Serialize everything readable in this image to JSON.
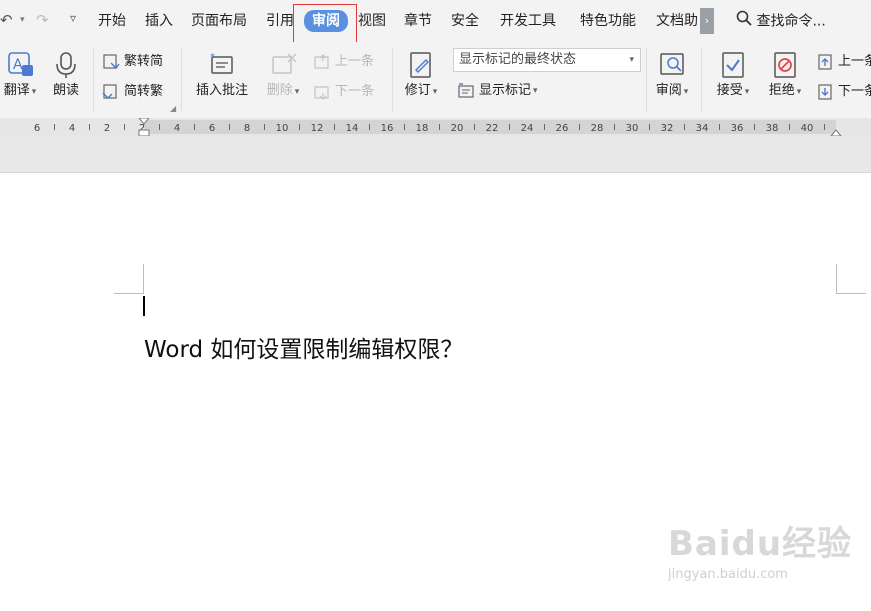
{
  "menu": {
    "tabs": [
      {
        "label": "开始"
      },
      {
        "label": "插入"
      },
      {
        "label": "页面布局"
      },
      {
        "label": "引用"
      },
      {
        "label": "审阅",
        "active": true
      },
      {
        "label": "视图"
      },
      {
        "label": "章节"
      },
      {
        "label": "安全"
      },
      {
        "label": "开发工具"
      },
      {
        "label": "特色功能"
      },
      {
        "label": "文档助"
      }
    ],
    "search_label": "查找命令...",
    "more_label": "›"
  },
  "ribbon": {
    "translate": "翻译",
    "read_aloud": "朗读",
    "to_traditional": "繁转简",
    "to_simplified": "简转繁",
    "insert_comment": "插入批注",
    "delete": "删除",
    "prev_comment": "上一条",
    "next_comment": "下一条",
    "track_changes": "修订",
    "markup_state": "显示标记的最终状态",
    "show_markup": "显示标记",
    "review_pane": "审阅",
    "accept": "接受",
    "reject": "拒绝",
    "prev_change": "上一条",
    "next_change": "下一条"
  },
  "ruler": {
    "labels": [
      "6",
      "4",
      "2",
      "2",
      "4",
      "6",
      "8",
      "10",
      "12",
      "14",
      "16",
      "18",
      "20",
      "22",
      "24",
      "26",
      "28",
      "30",
      "32",
      "34",
      "36",
      "38",
      "40"
    ]
  },
  "document": {
    "text": "Word 如何设置限制编辑权限？"
  },
  "watermark": {
    "main": "Baidu经验",
    "sub": "jingyan.baidu.com"
  },
  "colors": {
    "active_tab": "#5b8fe0",
    "highlight_box": "#e23b3b",
    "chrome_bg": "#f3f3f3"
  }
}
